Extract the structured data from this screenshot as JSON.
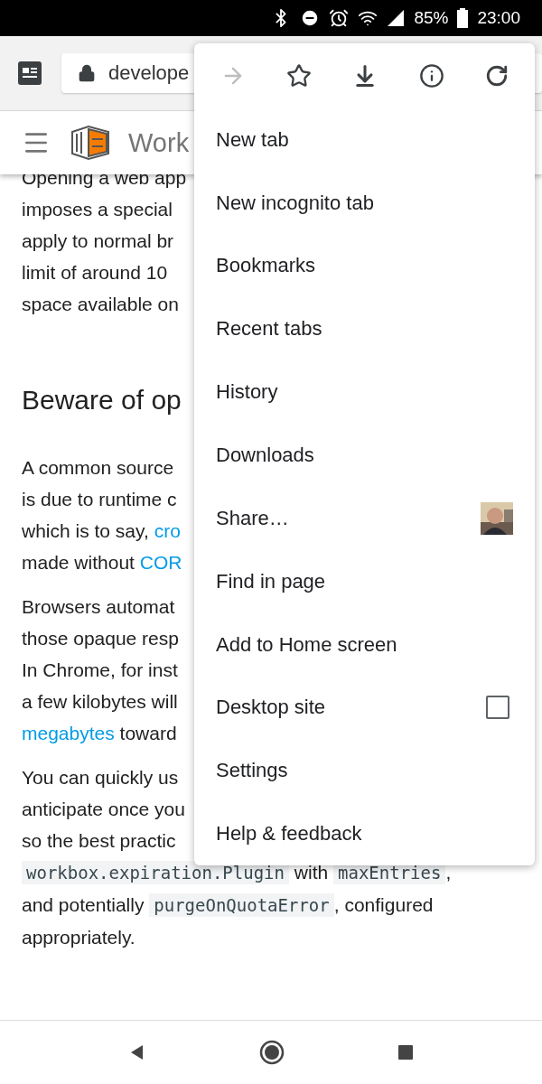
{
  "status_bar": {
    "battery": "85%",
    "time": "23:00"
  },
  "toolbar": {
    "url": "develope"
  },
  "site_header": {
    "title": "Work"
  },
  "article": [
    {
      "kind": "paragraph",
      "lines": [
        [
          {
            "kind": "text",
            "text": "Opening a web app"
          }
        ],
        [
          {
            "kind": "text",
            "text": "imposes a special"
          }
        ],
        [
          {
            "kind": "text",
            "text": "apply to normal br"
          }
        ],
        [
          {
            "kind": "text",
            "text": "limit of around 10"
          }
        ],
        [
          {
            "kind": "text",
            "text": "space available on"
          }
        ]
      ]
    },
    {
      "kind": "heading",
      "text": "Beware of op"
    },
    {
      "kind": "paragraph",
      "lines": [
        [
          {
            "kind": "text",
            "text": "A common source"
          }
        ],
        [
          {
            "kind": "text",
            "text": "is due to runtime c"
          }
        ],
        [
          {
            "kind": "text",
            "text": "which is to say, "
          },
          {
            "kind": "link",
            "text": "cro"
          }
        ],
        [
          {
            "kind": "text",
            "text": "made without "
          },
          {
            "kind": "link",
            "text": "COR"
          }
        ]
      ]
    },
    {
      "kind": "paragraph",
      "lines": [
        [
          {
            "kind": "text",
            "text": "Browsers automat"
          }
        ],
        [
          {
            "kind": "text",
            "text": "those opaque resp"
          }
        ],
        [
          {
            "kind": "text",
            "text": "In Chrome, for inst"
          }
        ],
        [
          {
            "kind": "text",
            "text": "a few kilobytes will"
          }
        ],
        [
          {
            "kind": "link",
            "text": "megabytes"
          },
          {
            "kind": "text",
            "text": " toward"
          }
        ]
      ]
    },
    {
      "kind": "paragraph",
      "lines": [
        [
          {
            "kind": "text",
            "text": "You can quickly us"
          }
        ],
        [
          {
            "kind": "text",
            "text": "anticipate once you"
          }
        ],
        [
          {
            "kind": "text",
            "text": "so the best practic"
          }
        ],
        [
          {
            "kind": "code",
            "text": "workbox.expiration.Plugin"
          },
          {
            "kind": "text",
            "text": " with "
          },
          {
            "kind": "code",
            "text": "maxEntries"
          },
          {
            "kind": "text",
            "text": ","
          }
        ],
        [
          {
            "kind": "text",
            "text": "and potentially "
          },
          {
            "kind": "code",
            "text": "purgeOnQuotaError"
          },
          {
            "kind": "text",
            "text": ", configured"
          }
        ],
        [
          {
            "kind": "text",
            "text": "appropriately."
          }
        ]
      ]
    }
  ],
  "menu": {
    "icons": [
      {
        "kind": "forward",
        "disabled": true
      },
      {
        "kind": "bookmark",
        "disabled": false
      },
      {
        "kind": "download",
        "disabled": false
      },
      {
        "kind": "info",
        "disabled": false
      },
      {
        "kind": "reload",
        "disabled": false
      }
    ],
    "items": [
      {
        "kind": "plain",
        "label": "New tab"
      },
      {
        "kind": "plain",
        "label": "New incognito tab"
      },
      {
        "kind": "plain",
        "label": "Bookmarks"
      },
      {
        "kind": "plain",
        "label": "Recent tabs"
      },
      {
        "kind": "plain",
        "label": "History"
      },
      {
        "kind": "plain",
        "label": "Downloads"
      },
      {
        "kind": "share",
        "label": "Share…"
      },
      {
        "kind": "plain",
        "label": "Find in page"
      },
      {
        "kind": "plain",
        "label": "Add to Home screen"
      },
      {
        "kind": "checkbox",
        "label": "Desktop site",
        "checked": false
      },
      {
        "kind": "plain",
        "label": "Settings"
      },
      {
        "kind": "plain",
        "label": "Help & feedback"
      }
    ]
  }
}
